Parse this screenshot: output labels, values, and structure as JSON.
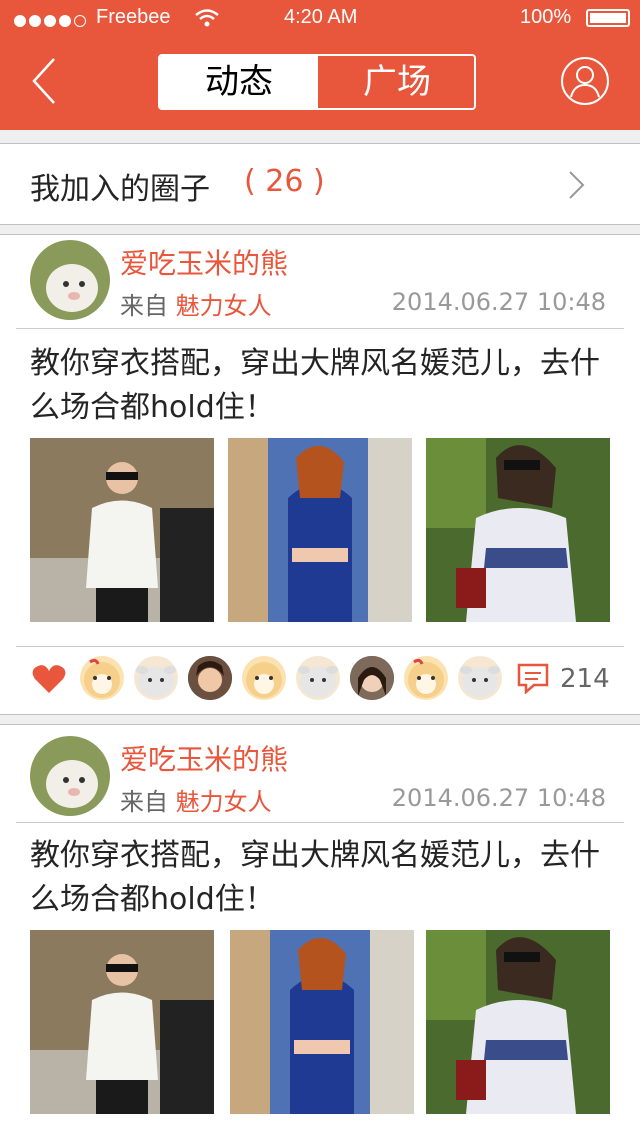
{
  "status_bar": {
    "carrier": "Freebee",
    "time": "4:20 AM",
    "battery": "100%"
  },
  "nav": {
    "tab_active": "动态",
    "tab_inactive": "广场"
  },
  "circles_row": {
    "label": "我加入的圈子",
    "count": "( 26 )"
  },
  "posts": [
    {
      "author": "爱吃玉米的熊",
      "from_prefix": "来自",
      "from_circle": "魅力女人",
      "time": "2014.06.27 10:48",
      "text": "教你穿衣搭配，穿出大牌风名媛范儿，去什么场合都hold住！",
      "comment_count": "214"
    },
    {
      "author": "爱吃玉米的熊",
      "from_prefix": "来自",
      "from_circle": "魅力女人",
      "time": "2014.06.27 10:48",
      "text": "教你穿衣搭配，穿出大牌风名媛范儿，去什么场合都hold住！"
    }
  ],
  "likers": [
    "hamster",
    "sheep",
    "girl",
    "hamster",
    "sheep",
    "girl",
    "hamster",
    "sheep"
  ],
  "colors": {
    "accent": "#e8563c",
    "text": "#242424",
    "sub": "#666666",
    "divider": "#c1c1c1",
    "gap": "#efefef",
    "line": "#cccccc"
  },
  "icons": [
    "back-icon",
    "profile-icon",
    "chevron-right-icon",
    "heart-icon",
    "comment-icon",
    "wifi-icon",
    "battery-icon"
  ]
}
